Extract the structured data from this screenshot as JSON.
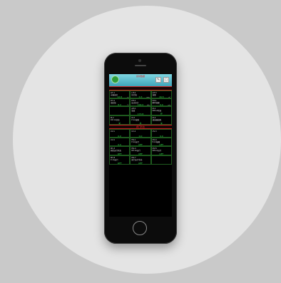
{
  "app": {
    "title": "实时数据",
    "section2_title": "阀门状态",
    "edit_button": "✎",
    "menu_button": "▢"
  },
  "screen": {
    "readings": [
      {
        "label": "LIT-1",
        "sub": "水箱液位",
        "value": "12.8",
        "unit": "m"
      },
      {
        "label": "LIT-2",
        "sub": "压力值",
        "value": "0.3",
        "unit": "mpa"
      },
      {
        "label": "LIT-3",
        "sub": "流量",
        "value": "16.5",
        "unit": "m³"
      },
      {
        "label": "TIT-1",
        "sub": "温度值",
        "value": "8.2",
        "unit": "℃"
      },
      {
        "label": "PIT-1",
        "sub": "出水压力",
        "value": "100.0",
        "unit": "kPa"
      },
      {
        "label": "FIT-1",
        "sub": "瞬时流量",
        "value": "0.0",
        "unit": "m/s"
      }
    ],
    "middle_cells": [
      {
        "label": "",
        "sub": "",
        "value": ""
      },
      {
        "label": "AIT-1",
        "sub": "浊度",
        "value": "173.8"
      },
      {
        "label": "M-1",
        "sub": "DP-1A状态",
        "value": "开"
      },
      {
        "label": "M-2",
        "sub": "DP-1A状态",
        "value": "关"
      },
      {
        "label": "M-3",
        "sub": "P-1A故障",
        "value": "关"
      },
      {
        "label": "M-4",
        "sub": "调速器故障",
        "value": "关"
      }
    ],
    "valves_row1": [
      {
        "label": "UV-1",
        "value": "0.0"
      },
      {
        "label": "UV-2",
        "value": "0.0"
      },
      {
        "label": "UV-3",
        "value": "0.0"
      },
      {
        "label": "UV-4",
        "value": "0.0"
      },
      {
        "label": "MV-1",
        "sub": "P-1A运行",
        "value": "OFF"
      },
      {
        "label": "MV-2",
        "sub": "P-1A故障",
        "value": "OFF"
      }
    ],
    "valves_row2": [
      {
        "label": "MV-3",
        "sub": "阀位运行状态",
        "value": "OFF"
      },
      {
        "label": "MV-4",
        "sub": "DP-1A运行",
        "value": "OFF"
      },
      {
        "label": "MV-5",
        "sub": "DP-1A运行",
        "value": "OFF"
      },
      {
        "label": "MV-6",
        "sub": "P-1A运行",
        "value": "OFF"
      },
      {
        "label": "MV-7",
        "sub": "阀门运行状态",
        "value": "OFF"
      },
      {
        "label": "",
        "sub": "",
        "value": ""
      }
    ]
  }
}
